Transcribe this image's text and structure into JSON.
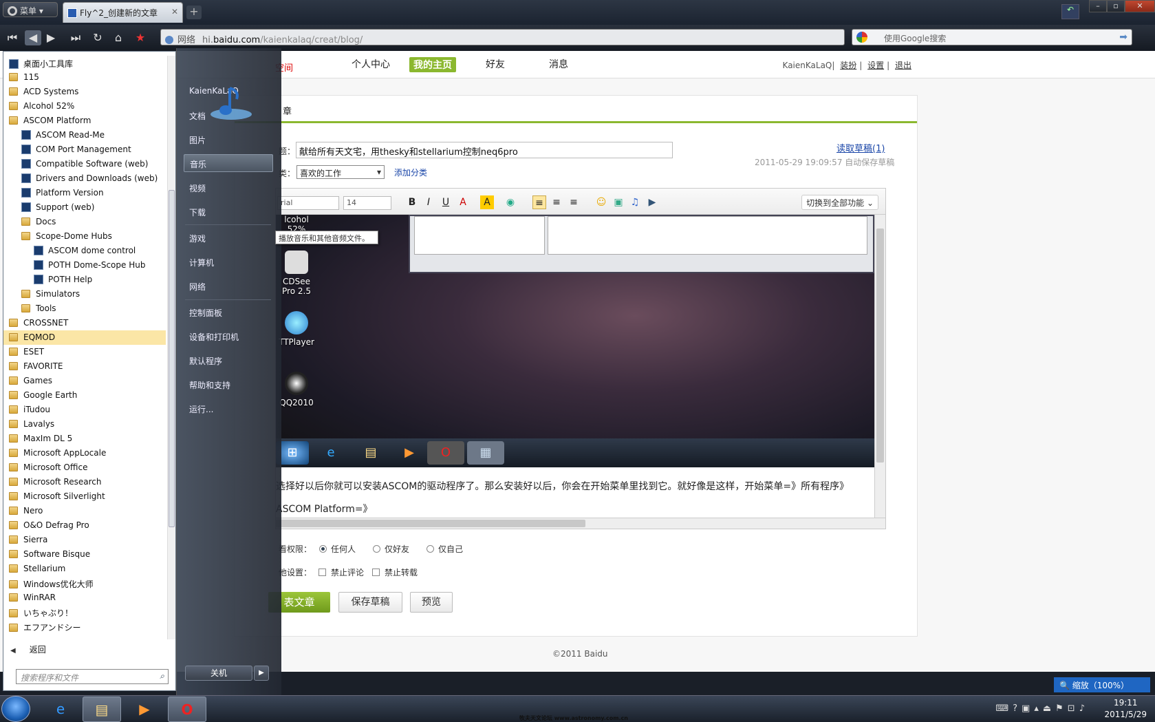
{
  "browser": {
    "menu_label": "菜单",
    "tab_title": "Fly^2_创建新的文章",
    "address_zone": "网络",
    "address_url_prefix": "hi.",
    "address_url_domain": "baidu.com",
    "address_url_path": "/kaienkalaq/creat/blog/",
    "search_placeholder": "使用Google搜索"
  },
  "site": {
    "brand_fragment": "空间",
    "nav": [
      "个人中心",
      "我的主页",
      "好友",
      "消息"
    ],
    "username": "KaienKaLaQ",
    "user_links": [
      "装扮",
      "设置",
      "退出"
    ]
  },
  "editor_page": {
    "panel_title": "章",
    "title_label": "题：",
    "title_value": "献给所有天文宅，用thesky和stellarium控制neq6pro",
    "draft_link": "读取草稿(1)",
    "autosave_text": "2011-05-29 19:09:57 自动保存草稿",
    "category_label": "类：",
    "category_value": "喜欢的工作",
    "add_category": "添加分类",
    "font_value": "rial",
    "size_value": "14",
    "full_toolbar_label": "切换到全部功能",
    "content_icons": [
      "lcohol 52%",
      "CDSee Pro 2.5",
      "TTPlayer",
      "QQ2010"
    ],
    "paragraph_1": "选择好以后你就可以安装ASCOM的驱动程序了。那么安装好以后，你会在开始菜单里找到它。就好像是这样，开始菜单=》所有程序》",
    "paragraph_2": "ASCOM Platform=》",
    "perm_label": "看权限：",
    "perm_options": [
      "任何人",
      "仅好友",
      "仅自己"
    ],
    "other_label": "他设置：",
    "other_options": [
      "禁止评论",
      "禁止转载"
    ],
    "publish_button": "表文章",
    "save_draft_button": "保存草稿",
    "preview_button": "预览",
    "footer": "©2011 Baidu"
  },
  "zoom": "缩放（100%）",
  "start_menu": {
    "programs": [
      {
        "label": "桌面小工具库",
        "type": "app",
        "indent": 0
      },
      {
        "label": "115",
        "type": "folder",
        "indent": 0
      },
      {
        "label": "ACD Systems",
        "type": "folder",
        "indent": 0
      },
      {
        "label": "Alcohol 52%",
        "type": "folder",
        "indent": 0
      },
      {
        "label": "ASCOM Platform",
        "type": "folder",
        "indent": 0
      },
      {
        "label": "ASCOM Read-Me",
        "type": "app",
        "indent": 1
      },
      {
        "label": "COM Port Management",
        "type": "app",
        "indent": 1
      },
      {
        "label": "Compatible Software (web)",
        "type": "app",
        "indent": 1
      },
      {
        "label": "Drivers and Downloads (web)",
        "type": "app",
        "indent": 1
      },
      {
        "label": "Platform Version",
        "type": "app",
        "indent": 1
      },
      {
        "label": "Support (web)",
        "type": "app",
        "indent": 1
      },
      {
        "label": "Docs",
        "type": "folder",
        "indent": 1
      },
      {
        "label": "Scope-Dome Hubs",
        "type": "folder",
        "indent": 1
      },
      {
        "label": "ASCOM dome control",
        "type": "app",
        "indent": 2
      },
      {
        "label": "POTH Dome-Scope Hub",
        "type": "app",
        "indent": 2
      },
      {
        "label": "POTH Help",
        "type": "app",
        "indent": 2
      },
      {
        "label": "Simulators",
        "type": "folder",
        "indent": 1
      },
      {
        "label": "Tools",
        "type": "folder",
        "indent": 1
      },
      {
        "label": "CROSSNET",
        "type": "folder",
        "indent": 0
      },
      {
        "label": "EQMOD",
        "type": "folder",
        "indent": 0,
        "selected": true
      },
      {
        "label": "ESET",
        "type": "folder",
        "indent": 0
      },
      {
        "label": "FAVORITE",
        "type": "folder",
        "indent": 0
      },
      {
        "label": "Games",
        "type": "folder",
        "indent": 0
      },
      {
        "label": "Google Earth",
        "type": "folder",
        "indent": 0
      },
      {
        "label": "iTudou",
        "type": "folder",
        "indent": 0
      },
      {
        "label": "Lavalys",
        "type": "folder",
        "indent": 0
      },
      {
        "label": "MaxIm DL 5",
        "type": "folder",
        "indent": 0
      },
      {
        "label": "Microsoft AppLocale",
        "type": "folder",
        "indent": 0
      },
      {
        "label": "Microsoft Office",
        "type": "folder",
        "indent": 0
      },
      {
        "label": "Microsoft Research",
        "type": "folder",
        "indent": 0
      },
      {
        "label": "Microsoft Silverlight",
        "type": "folder",
        "indent": 0
      },
      {
        "label": "Nero",
        "type": "folder",
        "indent": 0
      },
      {
        "label": "O&O Defrag Pro",
        "type": "folder",
        "indent": 0
      },
      {
        "label": "Sierra",
        "type": "folder",
        "indent": 0
      },
      {
        "label": "Software Bisque",
        "type": "folder",
        "indent": 0
      },
      {
        "label": "Stellarium",
        "type": "folder",
        "indent": 0
      },
      {
        "label": "Windows优化大师",
        "type": "folder",
        "indent": 0
      },
      {
        "label": "WinRAR",
        "type": "folder",
        "indent": 0
      },
      {
        "label": "いちゃぶり！",
        "type": "folder",
        "indent": 0
      },
      {
        "label": "エフアンドシー",
        "type": "folder",
        "indent": 0
      }
    ],
    "back_label": "返回",
    "search_placeholder": "搜索程序和文件",
    "right_items": [
      "KaienKaLaQ",
      "文档",
      "图片",
      "音乐",
      "视频",
      "下载",
      "游戏",
      "计算机",
      "网络",
      "控制面板",
      "设备和打印机",
      "默认程序",
      "帮助和支持",
      "运行..."
    ],
    "highlighted_item": "音乐",
    "tooltip": "播放音乐和其他音频文件。",
    "shutdown_label": "关机"
  },
  "taskbar": {
    "time": "19:11",
    "date": "2011/5/29"
  },
  "watermark": "牧夫天文论坛 www.astronomy.com.cn"
}
